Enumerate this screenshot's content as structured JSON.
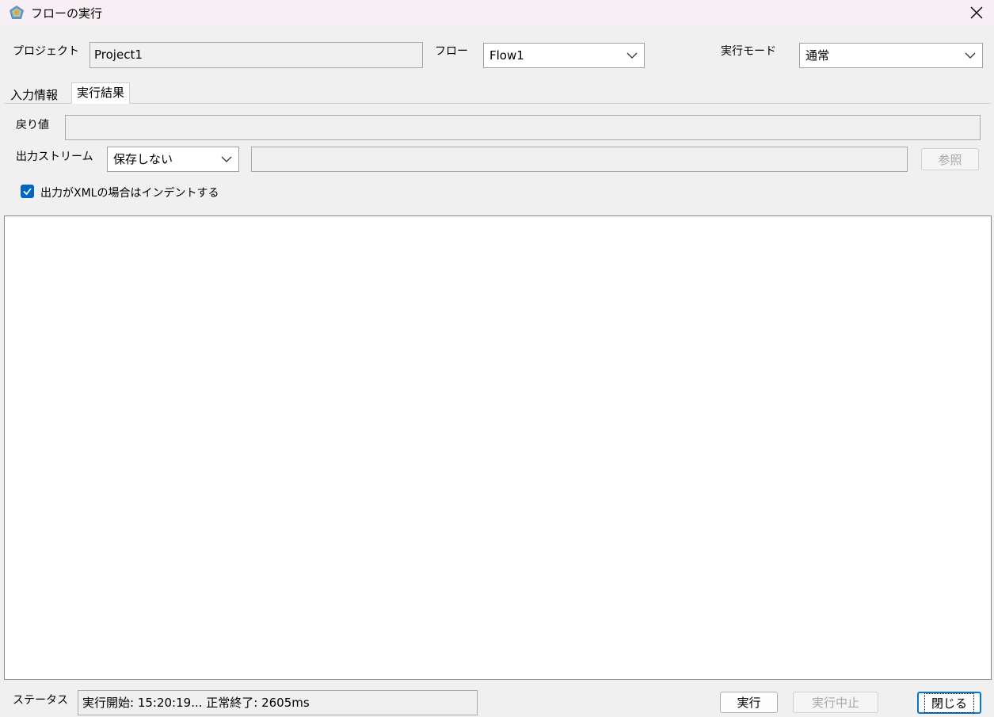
{
  "window": {
    "title": "フローの実行",
    "close_icon": "close-icon"
  },
  "project": {
    "label": "プロジェクト",
    "value": "Project1"
  },
  "flow": {
    "label": "フロー",
    "value": "Flow1"
  },
  "mode": {
    "label": "実行モード",
    "value": "通常"
  },
  "tabs": [
    {
      "label": "入力情報",
      "active": false
    },
    {
      "label": "実行結果",
      "active": true
    }
  ],
  "return_value": {
    "label": "戻り値",
    "value": ""
  },
  "output_stream": {
    "label": "出力ストリーム",
    "value": "保存しない",
    "path": "",
    "browse_label": "参照"
  },
  "indent_xml": {
    "label": "出力がXMLの場合はインデントする",
    "checked": true
  },
  "output": {
    "text": ""
  },
  "status": {
    "label": "ステータス",
    "value": "実行開始: 15:20:19... 正常終了: 2605ms"
  },
  "buttons": {
    "run": "実行",
    "stop": "実行中止",
    "close": "閉じる"
  },
  "colors": {
    "accent": "#0067c0",
    "titlebar": "#f6eff4",
    "background": "#f0f0f0"
  }
}
